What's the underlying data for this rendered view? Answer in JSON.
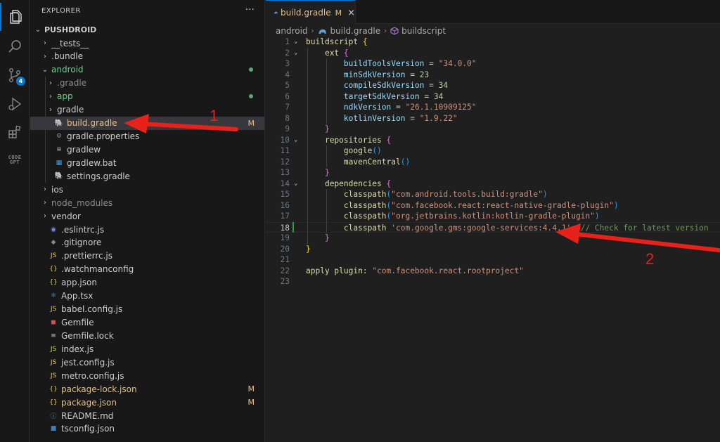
{
  "activity_bar": {
    "items": [
      {
        "icon": "files-icon"
      },
      {
        "icon": "search-icon"
      },
      {
        "icon": "source-control-icon",
        "badge": "4"
      },
      {
        "icon": "run-debug-icon"
      },
      {
        "icon": "extensions-icon"
      },
      {
        "icon": "codegpt-icon",
        "label": "CODE\nGPT"
      }
    ]
  },
  "sidebar": {
    "header": "EXPLORER",
    "more": "···",
    "root": "PUSHDROID",
    "items": [
      {
        "label": "__tests__",
        "type": "folder",
        "depth": 1,
        "chev": "›"
      },
      {
        "label": ".bundle",
        "type": "folder",
        "depth": 1,
        "chev": "›"
      },
      {
        "label": "android",
        "type": "folder-open",
        "depth": 1,
        "chev": "⌄",
        "color": "#73c991",
        "dot": true
      },
      {
        "label": ".gradle",
        "type": "folder",
        "depth": 2,
        "chev": "›",
        "color": "#8c8c8c"
      },
      {
        "label": "app",
        "type": "folder",
        "depth": 2,
        "chev": "›",
        "color": "#73c991",
        "dot": true
      },
      {
        "label": "gradle",
        "type": "folder",
        "depth": 2,
        "chev": "›"
      },
      {
        "label": "build.gradle",
        "type": "gradle",
        "depth": 2,
        "color": "#e2c08d",
        "status": "M",
        "selected": true
      },
      {
        "label": "gradle.properties",
        "type": "gear",
        "depth": 2
      },
      {
        "label": "gradlew",
        "type": "lines",
        "depth": 2
      },
      {
        "label": "gradlew.bat",
        "type": "windows",
        "depth": 2
      },
      {
        "label": "settings.gradle",
        "type": "gradle",
        "depth": 2
      },
      {
        "label": "ios",
        "type": "folder",
        "depth": 1,
        "chev": "›"
      },
      {
        "label": "node_modules",
        "type": "folder",
        "depth": 1,
        "chev": "›",
        "color": "#8c8c8c"
      },
      {
        "label": "vendor",
        "type": "folder",
        "depth": 1,
        "chev": "›"
      },
      {
        "label": ".eslintrc.js",
        "type": "eslint",
        "depth": 1
      },
      {
        "label": ".gitignore",
        "type": "git",
        "depth": 1
      },
      {
        "label": ".prettierrc.js",
        "type": "js",
        "depth": 1
      },
      {
        "label": ".watchmanconfig",
        "type": "json",
        "depth": 1
      },
      {
        "label": "app.json",
        "type": "json",
        "depth": 1
      },
      {
        "label": "App.tsx",
        "type": "react",
        "depth": 1
      },
      {
        "label": "babel.config.js",
        "type": "js",
        "depth": 1
      },
      {
        "label": "Gemfile",
        "type": "ruby",
        "depth": 1
      },
      {
        "label": "Gemfile.lock",
        "type": "lines",
        "depth": 1
      },
      {
        "label": "index.js",
        "type": "js",
        "depth": 1
      },
      {
        "label": "jest.config.js",
        "type": "js",
        "depth": 1
      },
      {
        "label": "metro.config.js",
        "type": "js",
        "depth": 1
      },
      {
        "label": "package-lock.json",
        "type": "json",
        "depth": 1,
        "color": "#e2c08d",
        "status": "M"
      },
      {
        "label": "package.json",
        "type": "json",
        "depth": 1,
        "color": "#e2c08d",
        "status": "M"
      },
      {
        "label": "README.md",
        "type": "info",
        "depth": 1
      },
      {
        "label": "tsconfig.json",
        "type": "tsconfig",
        "depth": 1
      }
    ]
  },
  "tab": {
    "name": "build.gradle",
    "modified": "M",
    "close": "×"
  },
  "breadcrumbs": [
    "android",
    "build.gradle",
    "buildscript"
  ],
  "code": {
    "active_line": 18,
    "modified_line": 18,
    "lines": [
      [
        [
          "k",
          "buildscript"
        ],
        [
          "t",
          " "
        ],
        [
          "br1",
          "{"
        ]
      ],
      [
        [
          "t",
          "    "
        ],
        [
          "k",
          "ext"
        ],
        [
          "t",
          " "
        ],
        [
          "br2",
          "{"
        ]
      ],
      [
        [
          "t",
          "        "
        ],
        [
          "p",
          "buildToolsVersion"
        ],
        [
          "t",
          " = "
        ],
        [
          "s",
          "\"34.0.0\""
        ]
      ],
      [
        [
          "t",
          "        "
        ],
        [
          "p",
          "minSdkVersion"
        ],
        [
          "t",
          " = "
        ],
        [
          "n",
          "23"
        ]
      ],
      [
        [
          "t",
          "        "
        ],
        [
          "p",
          "compileSdkVersion"
        ],
        [
          "t",
          " = "
        ],
        [
          "n",
          "34"
        ]
      ],
      [
        [
          "t",
          "        "
        ],
        [
          "p",
          "targetSdkVersion"
        ],
        [
          "t",
          " = "
        ],
        [
          "n",
          "34"
        ]
      ],
      [
        [
          "t",
          "        "
        ],
        [
          "p",
          "ndkVersion"
        ],
        [
          "t",
          " = "
        ],
        [
          "s",
          "\"26.1.10909125\""
        ]
      ],
      [
        [
          "t",
          "        "
        ],
        [
          "p",
          "kotlinVersion"
        ],
        [
          "t",
          " = "
        ],
        [
          "s",
          "\"1.9.22\""
        ]
      ],
      [
        [
          "t",
          "    "
        ],
        [
          "br2",
          "}"
        ]
      ],
      [
        [
          "t",
          "    "
        ],
        [
          "k",
          "repositories"
        ],
        [
          "t",
          " "
        ],
        [
          "br2",
          "{"
        ]
      ],
      [
        [
          "t",
          "        "
        ],
        [
          "f",
          "google"
        ],
        [
          "br3",
          "()"
        ]
      ],
      [
        [
          "t",
          "        "
        ],
        [
          "f",
          "mavenCentral"
        ],
        [
          "br3",
          "()"
        ]
      ],
      [
        [
          "t",
          "    "
        ],
        [
          "br2",
          "}"
        ]
      ],
      [
        [
          "t",
          "    "
        ],
        [
          "k",
          "dependencies"
        ],
        [
          "t",
          " "
        ],
        [
          "br2",
          "{"
        ]
      ],
      [
        [
          "t",
          "        "
        ],
        [
          "f",
          "classpath"
        ],
        [
          "br3",
          "("
        ],
        [
          "s",
          "\"com.android.tools.build:gradle\""
        ],
        [
          "br3",
          ")"
        ]
      ],
      [
        [
          "t",
          "        "
        ],
        [
          "f",
          "classpath"
        ],
        [
          "br3",
          "("
        ],
        [
          "s",
          "\"com.facebook.react:react-native-gradle-plugin\""
        ],
        [
          "br3",
          ")"
        ]
      ],
      [
        [
          "t",
          "        "
        ],
        [
          "f",
          "classpath"
        ],
        [
          "br3",
          "("
        ],
        [
          "s",
          "\"org.jetbrains.kotlin:kotlin-gradle-plugin\""
        ],
        [
          "br3",
          ")"
        ]
      ],
      [
        [
          "t",
          "        "
        ],
        [
          "f",
          "classpath"
        ],
        [
          "t",
          " "
        ],
        [
          "s",
          "'com.google.gms:google-services:4.4.1'"
        ],
        [
          "t",
          "  "
        ],
        [
          "cm",
          "// Check for latest version"
        ]
      ],
      [
        [
          "t",
          "    "
        ],
        [
          "br2",
          "}"
        ]
      ],
      [
        [
          "br1",
          "}"
        ]
      ],
      [
        [
          "t",
          ""
        ]
      ],
      [
        [
          "k",
          "apply plugin"
        ],
        [
          "t",
          ": "
        ],
        [
          "s",
          "\"com.facebook.react.rootproject\""
        ]
      ],
      [
        [
          "t",
          ""
        ]
      ]
    ],
    "folds": [
      1,
      2,
      10,
      14
    ]
  },
  "annotations": {
    "label1": "1",
    "label2": "2",
    "arrow_color": "#e8221b"
  }
}
